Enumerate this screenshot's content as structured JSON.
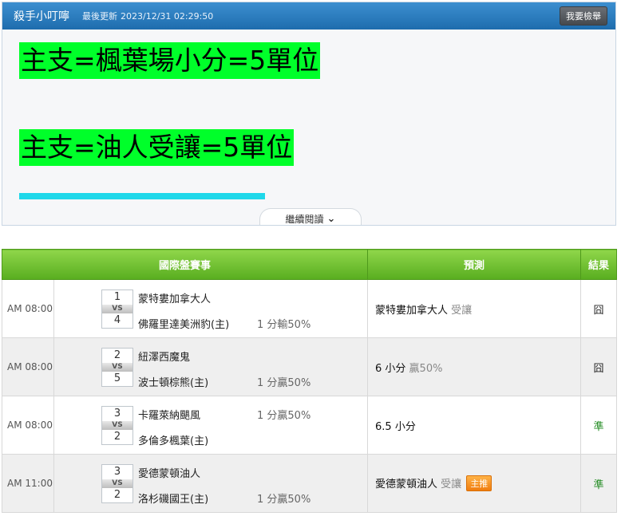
{
  "header": {
    "author": "殺手小叮嚀",
    "updated_label": "最後更新",
    "updated_time": "2023/12/31 02:29:50",
    "bet_button": "我要檢舉"
  },
  "picks": {
    "line1": "主支=楓葉場小分=5單位",
    "line2": "主支=油人受讓=5單位"
  },
  "read_more": {
    "label": "繼續閱讀",
    "icon": "chevron-down-icon"
  },
  "table": {
    "headers": {
      "event": "國際盤賽事",
      "prediction": "預測",
      "result": "結果"
    },
    "rows": [
      {
        "time": "AM 08:00",
        "score1": "1",
        "vs": "VS",
        "score2": "4",
        "team1": "蒙特婁加拿大人",
        "team2": "佛羅里達美洲豹(主)",
        "line1": "",
        "line2": "1 分輸50%",
        "pred_main": "蒙特婁加拿大人",
        "pred_note": " 受讓",
        "pred_badge": "",
        "result": "囧"
      },
      {
        "time": "AM 08:00",
        "score1": "2",
        "vs": "VS",
        "score2": "5",
        "team1": "紐澤西魔鬼",
        "team2": "波士頓棕熊(主)",
        "line1": "",
        "line2": "1 分贏50%",
        "pred_main": "6 小分",
        "pred_note": " 贏50%",
        "pred_badge": "",
        "result": "囧"
      },
      {
        "time": "AM 08:00",
        "score1": "3",
        "vs": "VS",
        "score2": "2",
        "team1": "卡羅萊納颶風",
        "team2": "多倫多楓葉(主)",
        "line1": "1 分贏50%",
        "line2": "",
        "pred_main": "6.5 小分",
        "pred_note": "",
        "pred_badge": "",
        "result": "準"
      },
      {
        "time": "AM 11:00",
        "score1": "3",
        "vs": "VS",
        "score2": "2",
        "team1": "愛德蒙頓油人",
        "team2": "洛杉磯國王(主)",
        "line1": "",
        "line2": "1 分贏50%",
        "pred_main": "愛德蒙頓油人",
        "pred_note": " 受讓",
        "pred_badge": "主推",
        "result": "準"
      }
    ]
  },
  "colors": {
    "header_blue": "#1e6cad",
    "highlight_green": "#00ff2a",
    "table_header_green": "#58ad1f",
    "win_green": "#1f8a1f",
    "badge_orange": "#f07c0e"
  }
}
